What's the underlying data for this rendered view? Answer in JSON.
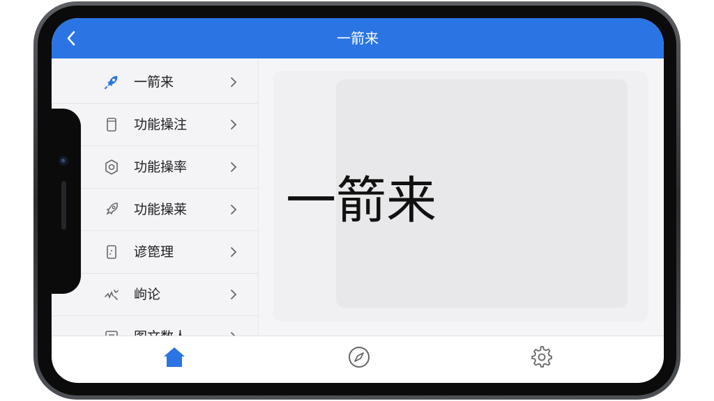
{
  "navbar": {
    "title": "一箭来"
  },
  "sidebar": {
    "items": [
      {
        "label": "一箭来",
        "icon": "rocket-icon"
      },
      {
        "label": "功能操注",
        "icon": "cylinder-icon"
      },
      {
        "label": "功能操率",
        "icon": "hexagon-gear-icon"
      },
      {
        "label": "功能操莱",
        "icon": "rocket-outline-icon"
      },
      {
        "label": "谚箆理",
        "icon": "clipboard-icon"
      },
      {
        "label": "岣论",
        "icon": "scribble-icon"
      },
      {
        "label": "图文数人",
        "icon": "image-icon"
      }
    ]
  },
  "content": {
    "heading": "一箭来"
  },
  "tabbar": {
    "tabs": [
      {
        "icon": "home-icon",
        "active": true
      },
      {
        "icon": "compass-icon",
        "active": false
      },
      {
        "icon": "gear-icon",
        "active": false
      }
    ]
  },
  "colors": {
    "accent": "#2b74e4",
    "background": "#f5f5f7"
  }
}
